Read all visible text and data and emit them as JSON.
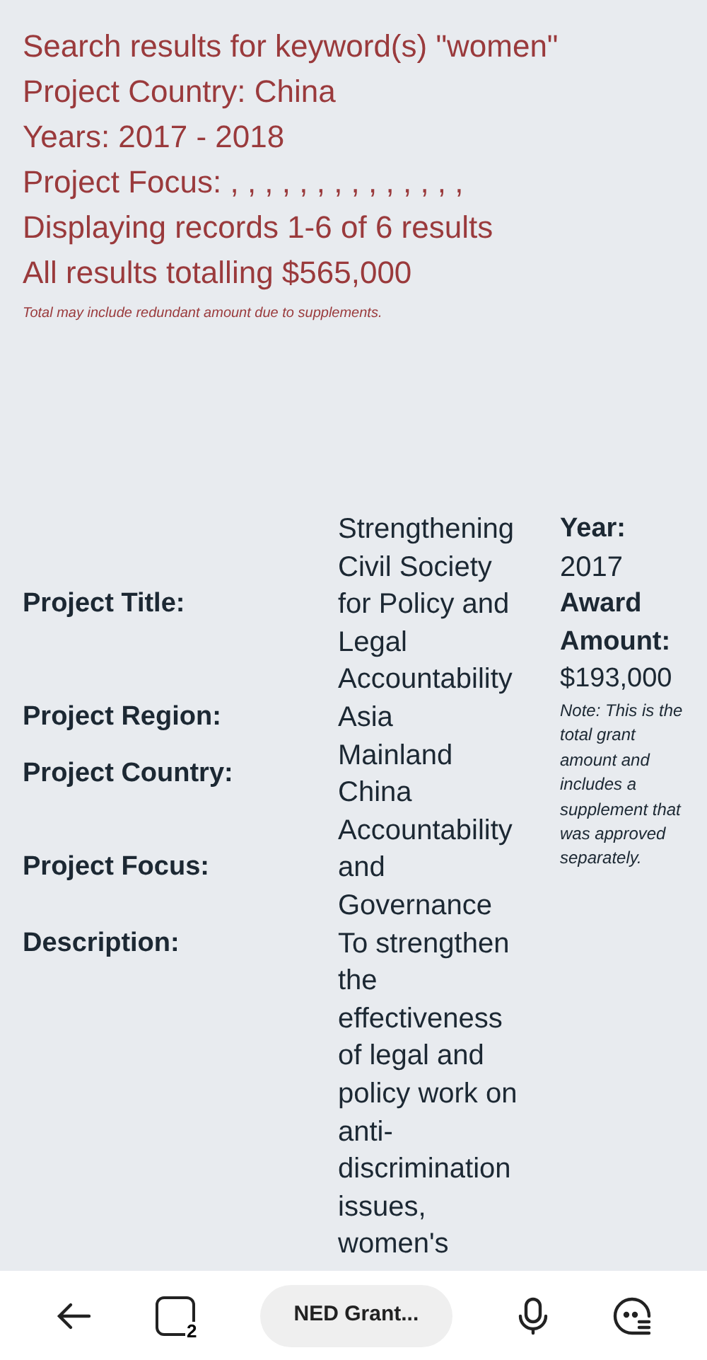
{
  "summary": {
    "lines": [
      "Search results for keyword(s) \"women\"",
      "Project Country: China",
      "Years: 2017 - 2018",
      "Project Focus: , , , , , , , , , , , , , ,",
      "Displaying records 1-6 of 6 results",
      "All results totalling $565,000"
    ],
    "note": "Total may include redundant amount due to supplements."
  },
  "record": {
    "fields": [
      {
        "kind": "short",
        "label": "Project Title:",
        "value": "Strengthening Civil Society for Policy and Legal Accountability"
      },
      {
        "kind": "short",
        "label": "Project Region:",
        "value": "Asia"
      },
      {
        "kind": "short",
        "label": "Project Country:",
        "value": "Mainland China"
      },
      {
        "kind": "short",
        "label": "Project Focus:",
        "value": "Accountability and Governance"
      },
      {
        "kind": "long",
        "label": "Description:",
        "value": "To strengthen the effectiveness of legal and policy work on anti-discrimination issues, women's"
      }
    ],
    "year_label": "Year:",
    "year": "2017",
    "amount_label": "Award Amount:",
    "amount": "$193,000",
    "amount_note": "Note: This is the total grant amount and includes a supplement that was approved separately."
  },
  "bottom_bar": {
    "tab_count": "2",
    "page_title": "NED Grant..."
  }
}
